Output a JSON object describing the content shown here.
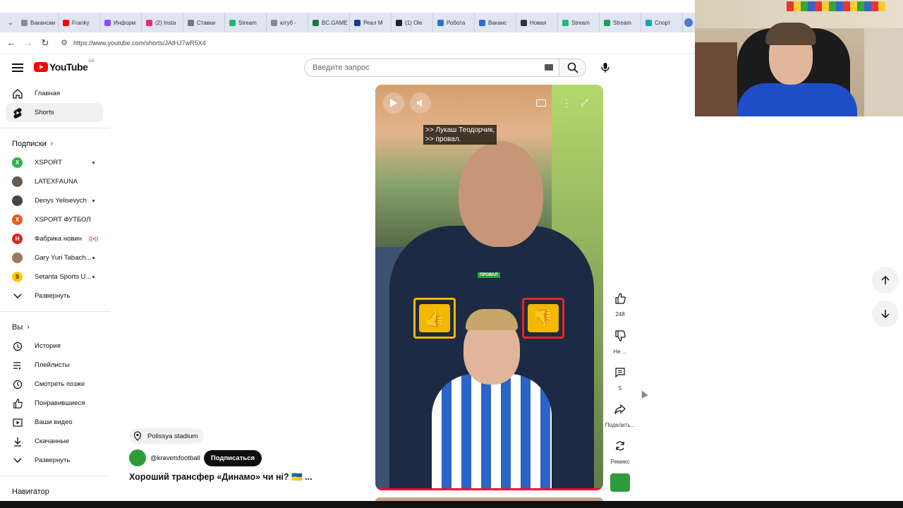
{
  "browser": {
    "tabs": [
      {
        "label": "Вакансии",
        "color": "#8a8a8a"
      },
      {
        "label": "Franky",
        "color": "#ff0000"
      },
      {
        "label": "Информ",
        "color": "#9146ff"
      },
      {
        "label": "(2) Insta",
        "color": "#e1306c"
      },
      {
        "label": "Ставки",
        "color": "#777777"
      },
      {
        "label": "Stream",
        "color": "#20b87a"
      },
      {
        "label": "ютуб -",
        "color": "#888888"
      },
      {
        "label": "BC.GAME",
        "color": "#1d7b3a"
      },
      {
        "label": "Реал М",
        "color": "#1a3a8a"
      },
      {
        "label": "(1) Ole",
        "color": "#222222"
      },
      {
        "label": "Робота",
        "color": "#2a6fd1"
      },
      {
        "label": "Ваканс",
        "color": "#2a6fd1"
      },
      {
        "label": "Новая",
        "color": "#333333"
      },
      {
        "label": "Stream",
        "color": "#20b87a"
      },
      {
        "label": "Stream",
        "color": "#1aa05a"
      },
      {
        "label": "Спорт",
        "color": "#17a2b8"
      }
    ],
    "url": "https://www.youtube.com/shorts/JAtHJ7wR5X4"
  },
  "youtube": {
    "logo_text": "YouTube",
    "logo_region": "UA",
    "search_placeholder": "Введите запрос",
    "sidebar": {
      "main": [
        {
          "label": "Главная",
          "icon": "home-icon"
        },
        {
          "label": "Shorts",
          "icon": "shorts-icon"
        }
      ],
      "subscriptions_heading": "Подписки",
      "subscriptions": [
        {
          "label": "XSPORT",
          "color": "#2bb34a",
          "letter": "X",
          "dot": true
        },
        {
          "label": "LATEXFAUNA",
          "color": "#6b5a4a",
          "letter": "",
          "dot": false
        },
        {
          "label": "Denys Yelisevych",
          "color": "#444444",
          "letter": "",
          "dot": true
        },
        {
          "label": "XSPORT ФУТБОЛ",
          "color": "#e85a1a",
          "letter": "X",
          "dot": false
        },
        {
          "label": "Фабрика новин",
          "color": "#d8232a",
          "letter": "Н",
          "live": true
        },
        {
          "label": "Gary Yuri Tabach...",
          "color": "#9a7a62",
          "letter": "",
          "dot": true
        },
        {
          "label": "Setanta Sports U...",
          "color": "#ffcc00",
          "letter": "S",
          "dot": true
        }
      ],
      "expand_label": "Развернуть",
      "you_heading": "Вы",
      "you_items": [
        {
          "label": "История",
          "icon": "history-icon"
        },
        {
          "label": "Плейлисты",
          "icon": "playlists-icon"
        },
        {
          "label": "Смотреть позже",
          "icon": "watch-later-icon"
        },
        {
          "label": "Понравившиеся",
          "icon": "liked-icon"
        },
        {
          "label": "Ваши видео",
          "icon": "your-videos-icon"
        },
        {
          "label": "Скачанные",
          "icon": "downloads-icon"
        }
      ],
      "expand_label_2": "Развернуть",
      "navigator_heading": "Навигатор"
    },
    "video": {
      "caption_line1": ">> Лукаш Теодорчик,",
      "caption_line2": ">> провал.",
      "badge": "ПРОВАЛ",
      "location": "Polissya stadium",
      "channel": "@kravetsfootball",
      "subscribe": "Подписаться",
      "title": "Хороший трансфер «Динамо» чи ні? 🇺🇦 ..."
    },
    "actions": {
      "likes": "248",
      "dislike": "Не ...",
      "comments": "5",
      "share": "Поделить...",
      "remix": "Ремикс"
    }
  }
}
